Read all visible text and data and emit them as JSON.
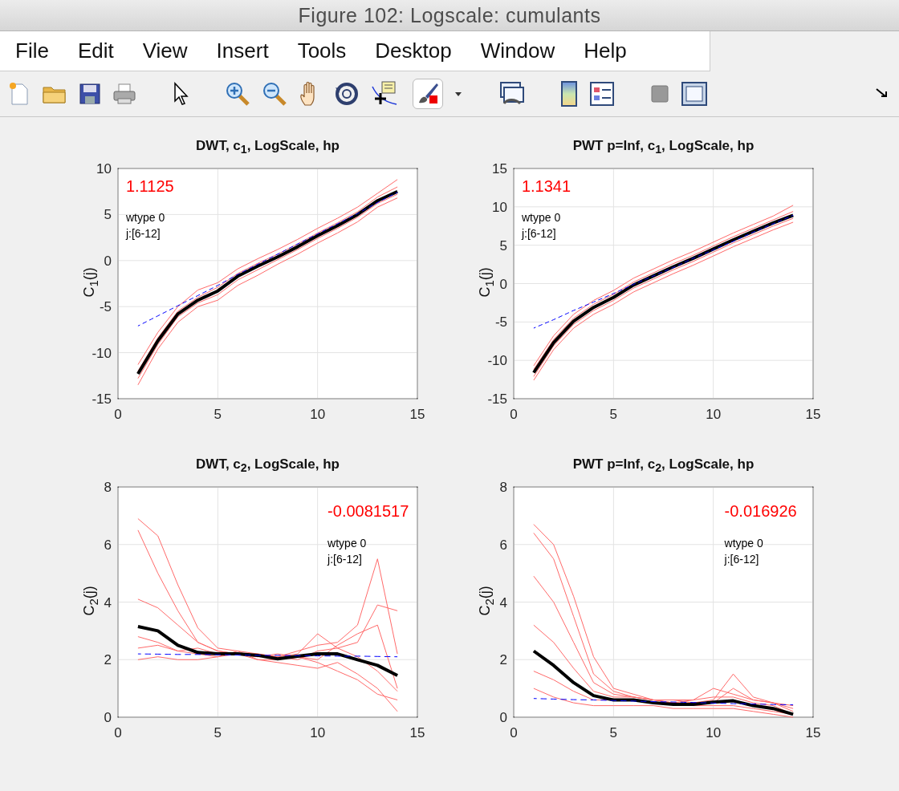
{
  "window": {
    "title": "Figure 102: Logscale: cumulants"
  },
  "menu": [
    "File",
    "Edit",
    "View",
    "Insert",
    "Tools",
    "Desktop",
    "Window",
    "Help"
  ],
  "charts": [
    {
      "title": "DWT, c$_{1}$, LogScale, hp",
      "ylabel": "C$_{1}$(j)",
      "chart_data": {
        "type": "line",
        "x": [
          1,
          2,
          3,
          4,
          5,
          6,
          7,
          8,
          9,
          10,
          11,
          12,
          13,
          14
        ],
        "xlim": [
          0,
          15
        ],
        "ylim": [
          -15,
          10
        ],
        "xticks": [
          0,
          5,
          10,
          15
        ],
        "yticks": [
          -15,
          -10,
          -5,
          0,
          5,
          10
        ],
        "grid": true,
        "series": [
          {
            "color": "#ff6a6a",
            "values": [
              -11.3,
              -7.8,
              -5.0,
              -3.2,
              -2.4,
              -0.9,
              0.2,
              1.2,
              2.3,
              3.5,
              4.6,
              5.8,
              7.3,
              8.8
            ]
          },
          {
            "color": "#ff6a6a",
            "values": [
              -13.5,
              -9.6,
              -6.7,
              -5.0,
              -4.3,
              -2.7,
              -1.6,
              -0.4,
              0.7,
              1.9,
              3.0,
              4.2,
              5.8,
              6.8
            ]
          },
          {
            "color": "#ff6a6a",
            "values": [
              -12.0,
              -8.4,
              -5.5,
              -4.0,
              -2.9,
              -1.4,
              -0.3,
              0.7,
              1.8,
              3.0,
              4.1,
              5.3,
              6.9,
              8.0
            ]
          },
          {
            "color": "#ff6a6a",
            "values": [
              -12.8,
              -9.1,
              -6.1,
              -4.6,
              -3.7,
              -2.1,
              -1.0,
              0.1,
              1.2,
              2.4,
              3.5,
              4.7,
              6.2,
              7.2
            ]
          },
          {
            "color": "#000000",
            "values": [
              -12.3,
              -8.7,
              -5.8,
              -4.3,
              -3.3,
              -1.7,
              -0.6,
              0.4,
              1.5,
              2.7,
              3.8,
              5.0,
              6.5,
              7.5
            ]
          },
          {
            "color": "#0000ff",
            "line_style": "dashed",
            "values": [
              -7.1,
              -6.0,
              -4.9,
              -3.8,
              -2.7,
              -1.5,
              -0.4,
              0.7,
              1.8,
              2.9,
              4.0,
              5.1,
              6.3,
              7.4
            ]
          }
        ],
        "annotations": [
          "1.1125",
          "wtype 0",
          "j:[6-12]"
        ]
      }
    },
    {
      "title": "PWT p=Inf, c$_{1}$, LogScale, hp",
      "ylabel": "C$_{1}$(j)",
      "chart_data": {
        "type": "line",
        "x": [
          1,
          2,
          3,
          4,
          5,
          6,
          7,
          8,
          9,
          10,
          11,
          12,
          13,
          14
        ],
        "xlim": [
          0,
          15
        ],
        "ylim": [
          -15,
          15
        ],
        "xticks": [
          0,
          5,
          10,
          15
        ],
        "yticks": [
          -15,
          -10,
          -5,
          0,
          5,
          10,
          15
        ],
        "grid": true,
        "series": [
          {
            "color": "#ff6a6a",
            "values": [
              -10.7,
              -6.8,
              -4.0,
              -2.2,
              -0.9,
              0.7,
              1.9,
              3.1,
              4.2,
              5.4,
              6.6,
              7.7,
              8.8,
              10.2
            ]
          },
          {
            "color": "#ff6a6a",
            "values": [
              -12.6,
              -8.6,
              -5.8,
              -4.0,
              -2.7,
              -1.1,
              0.1,
              1.3,
              2.4,
              3.6,
              4.8,
              5.9,
              7.0,
              8.0
            ]
          },
          {
            "color": "#ff6a6a",
            "values": [
              -11.2,
              -7.3,
              -4.5,
              -2.7,
              -1.4,
              0.2,
              1.4,
              2.6,
              3.7,
              4.9,
              6.1,
              7.2,
              8.3,
              9.4
            ]
          },
          {
            "color": "#ff6a6a",
            "values": [
              -12.1,
              -8.1,
              -5.3,
              -3.5,
              -2.2,
              -0.6,
              0.6,
              1.8,
              2.9,
              4.1,
              5.3,
              6.4,
              7.5,
              8.5
            ]
          },
          {
            "color": "#000000",
            "values": [
              -11.6,
              -7.7,
              -4.9,
              -3.1,
              -1.8,
              -0.2,
              1.0,
              2.2,
              3.3,
              4.5,
              5.7,
              6.8,
              7.9,
              8.9
            ]
          },
          {
            "color": "#0000ff",
            "line_style": "dashed",
            "values": [
              -5.8,
              -4.7,
              -3.5,
              -2.4,
              -1.3,
              -0.1,
              1.0,
              2.1,
              3.3,
              4.4,
              5.5,
              6.7,
              7.8,
              8.9
            ]
          }
        ],
        "annotations": [
          "1.1341",
          "wtype 0",
          "j:[6-12]"
        ]
      }
    },
    {
      "title": "DWT, c$_{2}$, LogScale, hp",
      "ylabel": "C$_{2}$(j)",
      "chart_data": {
        "type": "line",
        "x": [
          1,
          2,
          3,
          4,
          5,
          6,
          7,
          8,
          9,
          10,
          11,
          12,
          13,
          14
        ],
        "xlim": [
          0,
          15
        ],
        "ylim": [
          0,
          8
        ],
        "xticks": [
          0,
          5,
          10,
          15
        ],
        "yticks": [
          0,
          2,
          4,
          6,
          8
        ],
        "grid": true,
        "series": [
          {
            "color": "#ff6a6a",
            "values": [
              6.9,
              6.3,
              4.6,
              3.1,
              2.4,
              2.3,
              2.2,
              2.1,
              2.3,
              2.5,
              2.6,
              3.2,
              5.5,
              2.2
            ]
          },
          {
            "color": "#ff6a6a",
            "values": [
              6.5,
              5.0,
              3.7,
              2.6,
              2.3,
              2.2,
              2.2,
              2.1,
              2.2,
              2.9,
              2.4,
              2.6,
              3.9,
              3.7
            ]
          },
          {
            "color": "#ff6a6a",
            "values": [
              2.0,
              2.1,
              2.0,
              2.0,
              2.1,
              2.2,
              2.0,
              1.9,
              1.8,
              1.7,
              1.9,
              1.5,
              1.0,
              0.2
            ]
          },
          {
            "color": "#ff6a6a",
            "values": [
              2.4,
              2.5,
              2.3,
              2.4,
              2.2,
              2.2,
              2.1,
              2.1,
              2.0,
              2.3,
              2.4,
              2.1,
              1.6,
              0.9
            ]
          },
          {
            "color": "#ff6a6a",
            "values": [
              4.1,
              3.8,
              3.2,
              2.6,
              2.3,
              2.2,
              2.1,
              2.2,
              2.1,
              2.0,
              2.5,
              2.9,
              3.2,
              1.0
            ]
          },
          {
            "color": "#ff6a6a",
            "values": [
              2.8,
              2.6,
              2.3,
              2.2,
              2.1,
              2.3,
              2.0,
              2.0,
              2.1,
              1.9,
              1.6,
              1.3,
              0.8,
              0.6
            ]
          },
          {
            "color": "#000000",
            "values": [
              3.15,
              3.0,
              2.5,
              2.25,
              2.2,
              2.2,
              2.15,
              2.03,
              2.12,
              2.2,
              2.2,
              2.0,
              1.8,
              1.45
            ]
          },
          {
            "color": "#0000ff",
            "line_style": "dashed",
            "values": [
              2.2,
              2.19,
              2.18,
              2.18,
              2.17,
              2.16,
              2.15,
              2.15,
              2.14,
              2.13,
              2.12,
              2.12,
              2.11,
              2.1
            ]
          }
        ],
        "annotations": [
          "-0.0081517",
          "wtype 0",
          "j:[6-12]"
        ]
      }
    },
    {
      "title": "PWT p=Inf, c$_{2}$, LogScale, hp",
      "ylabel": "C$_{2}$(j)",
      "chart_data": {
        "type": "line",
        "x": [
          1,
          2,
          3,
          4,
          5,
          6,
          7,
          8,
          9,
          10,
          11,
          12,
          13,
          14
        ],
        "xlim": [
          0,
          15
        ],
        "ylim": [
          0,
          8
        ],
        "xticks": [
          0,
          5,
          10,
          15
        ],
        "yticks": [
          0,
          2,
          4,
          6,
          8
        ],
        "grid": true,
        "series": [
          {
            "color": "#ff6a6a",
            "values": [
              6.7,
              6.0,
              4.2,
              2.1,
              1.0,
              0.8,
              0.6,
              0.5,
              0.6,
              1.0,
              0.8,
              0.6,
              0.5,
              0.4
            ]
          },
          {
            "color": "#ff6a6a",
            "values": [
              6.4,
              5.5,
              3.5,
              1.5,
              0.9,
              0.7,
              0.6,
              0.6,
              0.5,
              0.6,
              1.5,
              0.7,
              0.5,
              0.3
            ]
          },
          {
            "color": "#ff6a6a",
            "values": [
              1.0,
              0.7,
              0.5,
              0.4,
              0.4,
              0.4,
              0.4,
              0.3,
              0.3,
              0.3,
              0.3,
              0.2,
              0.1,
              0.0
            ]
          },
          {
            "color": "#ff6a6a",
            "values": [
              3.2,
              2.6,
              1.7,
              0.9,
              0.7,
              0.7,
              0.6,
              0.6,
              0.6,
              0.7,
              0.7,
              0.5,
              0.4,
              0.1
            ]
          },
          {
            "color": "#ff6a6a",
            "values": [
              1.6,
              1.3,
              0.9,
              0.6,
              0.6,
              0.6,
              0.5,
              0.5,
              0.4,
              0.4,
              0.4,
              0.3,
              0.2,
              0.1
            ]
          },
          {
            "color": "#ff6a6a",
            "values": [
              4.9,
              4.0,
              2.6,
              1.2,
              0.8,
              0.7,
              0.6,
              0.5,
              0.5,
              0.5,
              1.0,
              0.6,
              0.5,
              0.2
            ]
          },
          {
            "color": "#000000",
            "values": [
              2.3,
              1.8,
              1.2,
              0.75,
              0.6,
              0.6,
              0.5,
              0.45,
              0.45,
              0.52,
              0.57,
              0.4,
              0.3,
              0.1
            ]
          },
          {
            "color": "#0000ff",
            "line_style": "dashed",
            "values": [
              0.65,
              0.63,
              0.61,
              0.6,
              0.58,
              0.56,
              0.54,
              0.53,
              0.51,
              0.49,
              0.47,
              0.46,
              0.44,
              0.43
            ]
          }
        ],
        "annotations": [
          "-0.016926",
          "wtype 0",
          "j:[6-12]"
        ]
      }
    }
  ]
}
